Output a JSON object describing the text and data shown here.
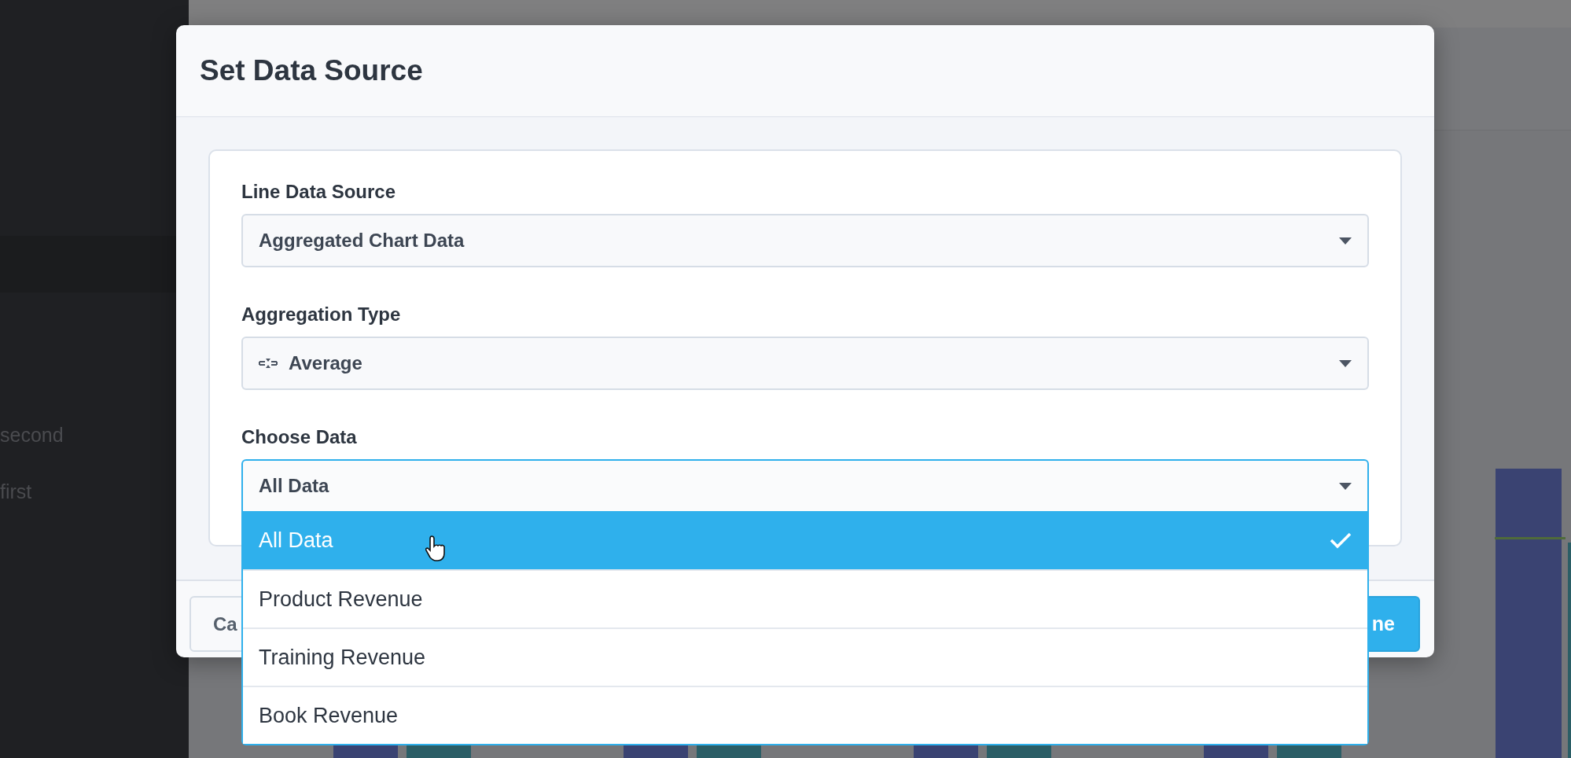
{
  "background": {
    "sidebar_items": [
      {
        "label": "second"
      },
      {
        "label": "first"
      }
    ]
  },
  "dialog": {
    "title": "Set Data Source",
    "fields": [
      {
        "label": "Line Data Source",
        "value": "Aggregated Chart Data",
        "kind": "plain",
        "open": false
      },
      {
        "label": "Aggregation Type",
        "value": "Average",
        "kind": "with-icon",
        "open": false
      },
      {
        "label": "Choose Data",
        "value": "All Data",
        "kind": "plain",
        "open": true,
        "options": [
          {
            "label": "All Data",
            "selected": true
          },
          {
            "label": "Product Revenue",
            "selected": false
          },
          {
            "label": "Training Revenue",
            "selected": false
          },
          {
            "label": "Book Revenue",
            "selected": false
          }
        ]
      }
    ],
    "buttons": [
      {
        "label": "Ca",
        "kind": "secondary"
      },
      {
        "label": "ne",
        "kind": "primary"
      }
    ]
  }
}
